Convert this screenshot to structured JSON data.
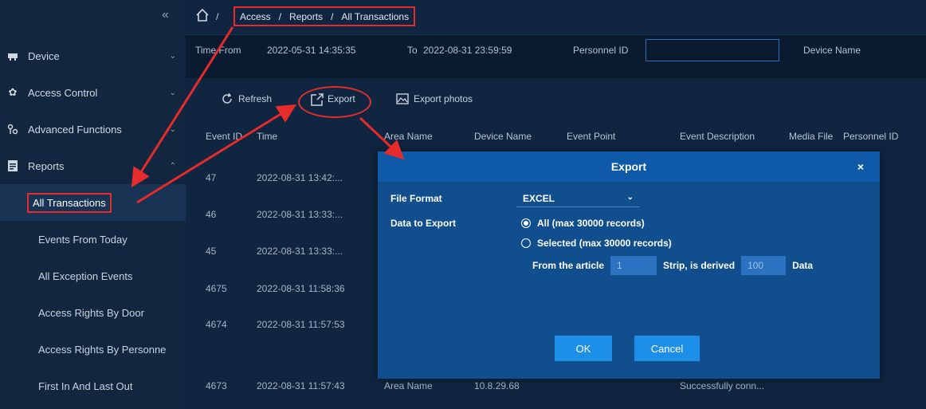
{
  "sidebar": {
    "collapse_glyph": "«",
    "items": [
      {
        "label": "Device",
        "icon": "device-icon"
      },
      {
        "label": "Access Control",
        "icon": "gear-icon"
      },
      {
        "label": "Advanced Functions",
        "icon": "functions-icon"
      },
      {
        "label": "Reports",
        "icon": "report-icon"
      }
    ],
    "subitems": [
      {
        "label": "All Transactions"
      },
      {
        "label": "Events From Today"
      },
      {
        "label": "All Exception Events"
      },
      {
        "label": "Access Rights By Door"
      },
      {
        "label": "Access Rights By Personne"
      },
      {
        "label": "First In And Last Out"
      }
    ]
  },
  "breadcrumb": {
    "root_sep": "/",
    "parts": [
      "Access",
      "/",
      "Reports",
      "/",
      "All Transactions"
    ]
  },
  "filters": {
    "time_from_label": "Time From",
    "time_from_value": "2022-05-31 14:35:35",
    "to_label": "To",
    "to_value": "2022-08-31 23:59:59",
    "personnel_label": "Personnel ID",
    "personnel_value": "",
    "device_label": "Device Name"
  },
  "toolbar": {
    "refresh": "Refresh",
    "export": "Export",
    "export_photos": "Export photos"
  },
  "table": {
    "headers": [
      "Event ID",
      "Time",
      "Area Name",
      "Device Name",
      "Event Point",
      "Event Description",
      "Media File",
      "Personnel ID"
    ],
    "rows": [
      {
        "id": "47",
        "time": "2022-08-31 13:42:..."
      },
      {
        "id": "46",
        "time": "2022-08-31 13:33:..."
      },
      {
        "id": "45",
        "time": "2022-08-31 13:33:..."
      },
      {
        "id": "4675",
        "time": "2022-08-31 11:58:36"
      },
      {
        "id": "4674",
        "time": "2022-08-31 11:57:53"
      },
      {
        "id": "4673",
        "time": "2022-08-31 11:57:43",
        "area": "Area Name",
        "device": "10.8.29.68",
        "desc": "Successfully conn..."
      }
    ]
  },
  "dialog": {
    "title": "Export",
    "close": "×",
    "file_format_label": "File Format",
    "file_format_value": "EXCEL",
    "data_label": "Data to Export",
    "opt_all": "All (max 30000 records)",
    "opt_selected": "Selected (max 30000 records)",
    "from_label": "From the article",
    "from_value": "1",
    "strip_label": "Strip, is derived",
    "strip_value": "100",
    "data_suffix": "Data",
    "ok": "OK",
    "cancel": "Cancel"
  }
}
